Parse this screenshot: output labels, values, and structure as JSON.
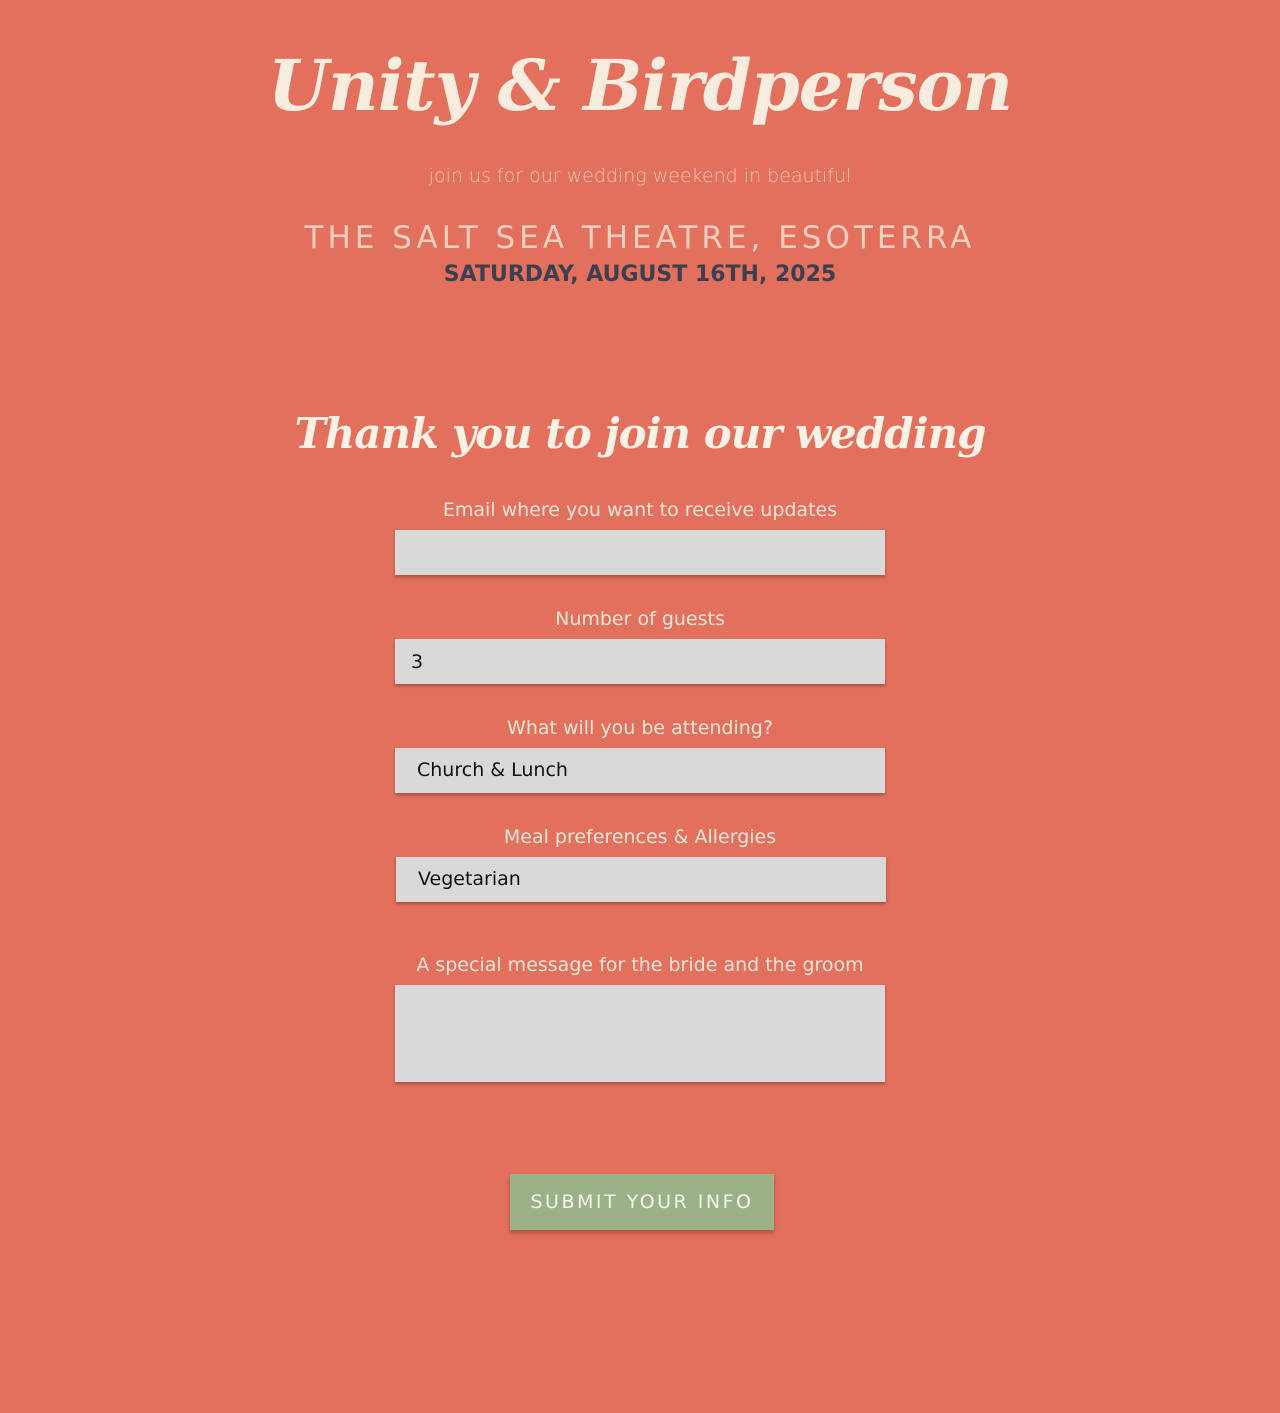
{
  "header": {
    "couple": "Unity & Birdperson",
    "intro": "join us for our wedding weekend in beautiful",
    "venue": "THE SALT SEA THEATRE, ESOTERRA",
    "date": "SATURDAY, AUGUST 16TH, 2025"
  },
  "form": {
    "title": "Thank you to join our wedding",
    "email": {
      "label": "Email where you want to receive updates",
      "value": ""
    },
    "guests": {
      "label": "Number of guests",
      "value": "3"
    },
    "attending": {
      "label": "What will you be attending?",
      "selected": "Church & Lunch"
    },
    "meal": {
      "label": "Meal preferences & Allergies",
      "selected": "Vegetarian"
    },
    "message": {
      "label": "A special message for the bride and the groom",
      "value": ""
    },
    "submit_label": "SUBMIT YOUR INFO"
  },
  "colors": {
    "background": "#e2705d",
    "field": "#d9d9d9",
    "button": "#9db189",
    "date_text": "#3b3f50"
  }
}
